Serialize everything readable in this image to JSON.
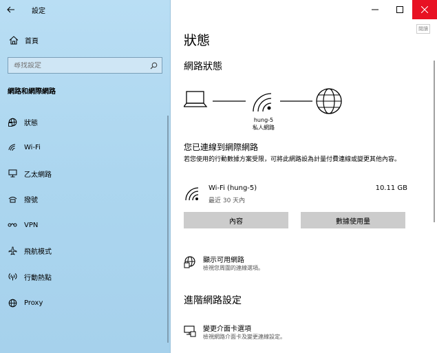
{
  "window": {
    "title": "設定"
  },
  "sidebar": {
    "home_label": "首頁",
    "search_placeholder": "尋找設定",
    "section_title": "網路和網際網路",
    "items": [
      {
        "label": "狀態",
        "icon": "globe-status-icon"
      },
      {
        "label": "Wi-Fi",
        "icon": "wifi-icon"
      },
      {
        "label": "乙太網路",
        "icon": "ethernet-icon"
      },
      {
        "label": "撥號",
        "icon": "dialup-icon"
      },
      {
        "label": "VPN",
        "icon": "vpn-icon"
      },
      {
        "label": "飛航模式",
        "icon": "airplane-icon"
      },
      {
        "label": "行動熱點",
        "icon": "hotspot-icon"
      },
      {
        "label": "Proxy",
        "icon": "globe-icon"
      }
    ]
  },
  "main": {
    "corner_tag": "閱讀",
    "title": "狀態",
    "subtitle": "網路狀態",
    "network": {
      "name": "hung-5",
      "type": "私人網路"
    },
    "connected_title": "您已連線到網際網路",
    "connected_desc": "若您使用的行動數據方案受限，可將此網路設為計量付費連線或變更其他內容。",
    "wifi": {
      "name": "Wi-Fi (hung-5)",
      "period": "最近 30 天內",
      "usage": "10.11 GB"
    },
    "buttons": {
      "properties": "內容",
      "data_usage": "數據使用量"
    },
    "show_networks": {
      "title": "顯示可用網路",
      "desc": "檢視您周圍的連線選項。"
    },
    "advanced_title": "進階網路設定",
    "change_adapter": {
      "title": "變更介面卡選項",
      "desc": "檢視網路介面卡及變更連線設定。"
    }
  },
  "colors": {
    "sidebar_bg": "#acd6ef",
    "close_button": "#e81123",
    "button_bg": "#cccccc"
  }
}
